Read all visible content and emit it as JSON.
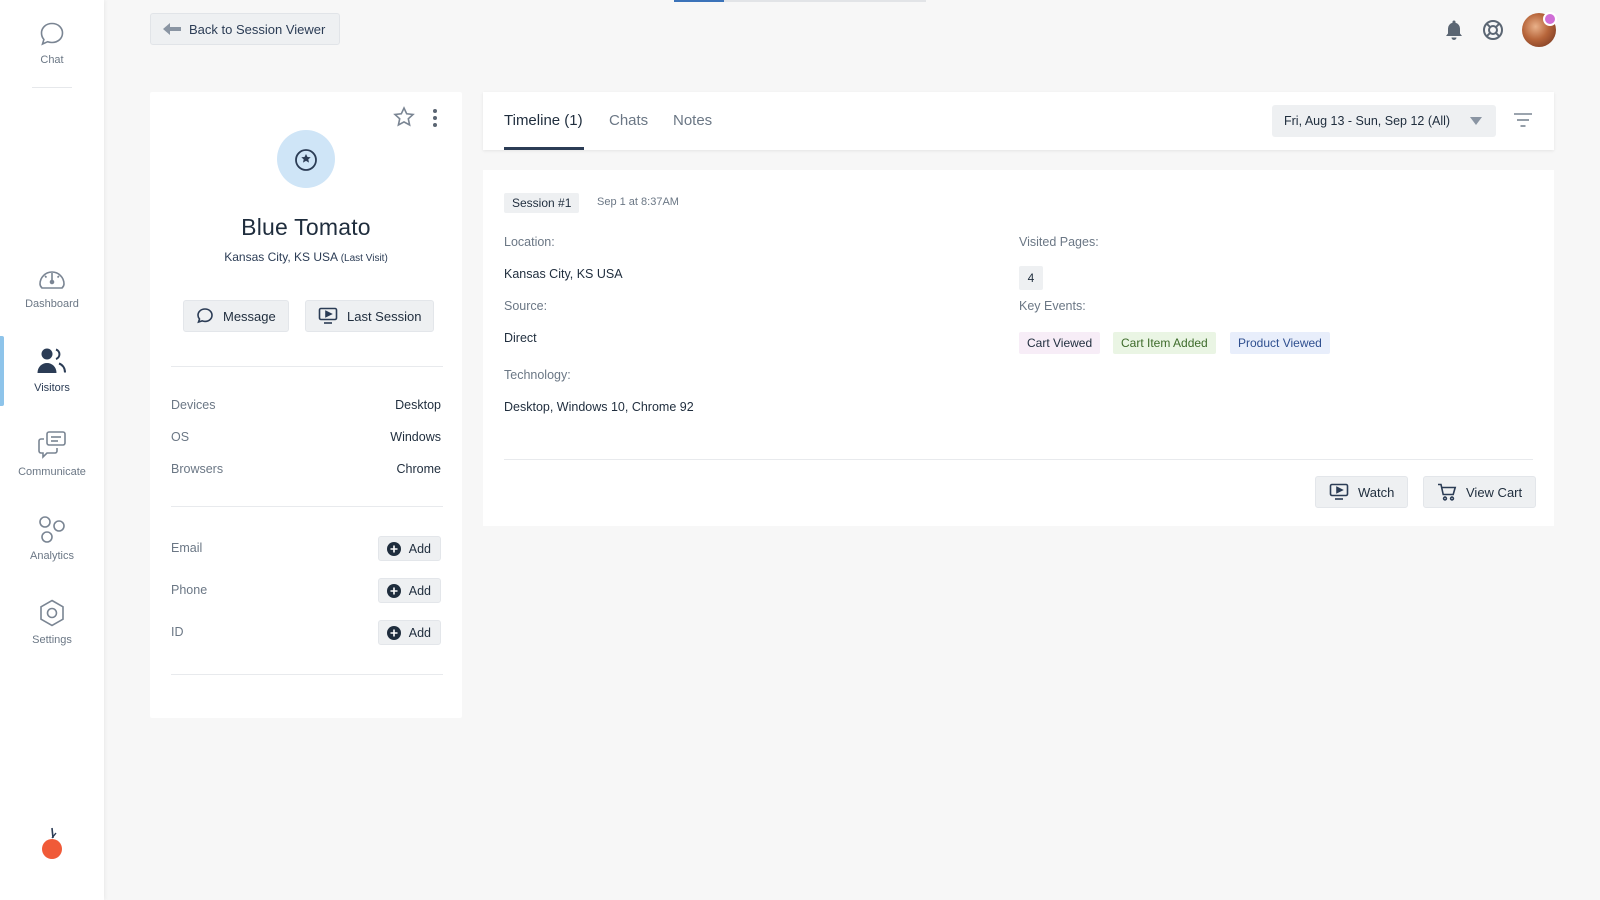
{
  "sidebar": {
    "items": [
      {
        "label": "Chat",
        "icon": "chat-bubble-icon"
      },
      {
        "label": "Dashboard",
        "icon": "speedometer-icon"
      },
      {
        "label": "Visitors",
        "icon": "people-icon"
      },
      {
        "label": "Communicate",
        "icon": "messages-icon"
      },
      {
        "label": "Analytics",
        "icon": "analytics-circles-icon"
      },
      {
        "label": "Settings",
        "icon": "hexagon-gear-icon"
      }
    ],
    "active": "Visitors",
    "logo_icon": "tomato-logo-icon"
  },
  "header": {
    "back_label": "Back to Session Viewer",
    "icons": [
      "bell-icon",
      "help-lifebuoy-icon"
    ],
    "avatar_status_color": "#d06ed6"
  },
  "profile": {
    "name": "Blue Tomato",
    "location": "Kansas City, KS USA",
    "location_note": "(Last Visit)",
    "message_label": "Message",
    "last_session_label": "Last Session",
    "details": [
      {
        "label": "Devices",
        "value": "Desktop"
      },
      {
        "label": "OS",
        "value": "Windows"
      },
      {
        "label": "Browsers",
        "value": "Chrome"
      }
    ],
    "contacts": [
      {
        "label": "Email",
        "action": "Add"
      },
      {
        "label": "Phone",
        "action": "Add"
      },
      {
        "label": "ID",
        "action": "Add"
      }
    ]
  },
  "tabs": {
    "items": [
      "Timeline (1)",
      "Chats",
      "Notes"
    ],
    "active": "Timeline (1)",
    "date_range": "Fri, Aug 13 - Sun, Sep 12 (All)"
  },
  "session": {
    "badge": "Session #1",
    "time": "Sep 1 at 8:37AM",
    "location_label": "Location:",
    "location_value": "Kansas City, KS USA",
    "source_label": "Source:",
    "source_value": "Direct",
    "technology_label": "Technology:",
    "technology_value": "Desktop, Windows 10, Chrome 92",
    "visited_pages_label": "Visited Pages:",
    "visited_pages_value": "4",
    "key_events_label": "Key Events:",
    "key_events": [
      {
        "label": "Cart Viewed",
        "bg": "#f7edf7",
        "color": "#1f2d3d"
      },
      {
        "label": "Cart Item Added",
        "bg": "#eaf5e4",
        "color": "#3d6b2a"
      },
      {
        "label": "Product Viewed",
        "bg": "#e8eefb",
        "color": "#2f4f8f"
      }
    ],
    "watch_label": "Watch",
    "view_cart_label": "View Cart"
  },
  "colors": {
    "accent": "#8ec4ea",
    "text_dark": "#1f2d3d",
    "text_muted": "#6b7785"
  }
}
